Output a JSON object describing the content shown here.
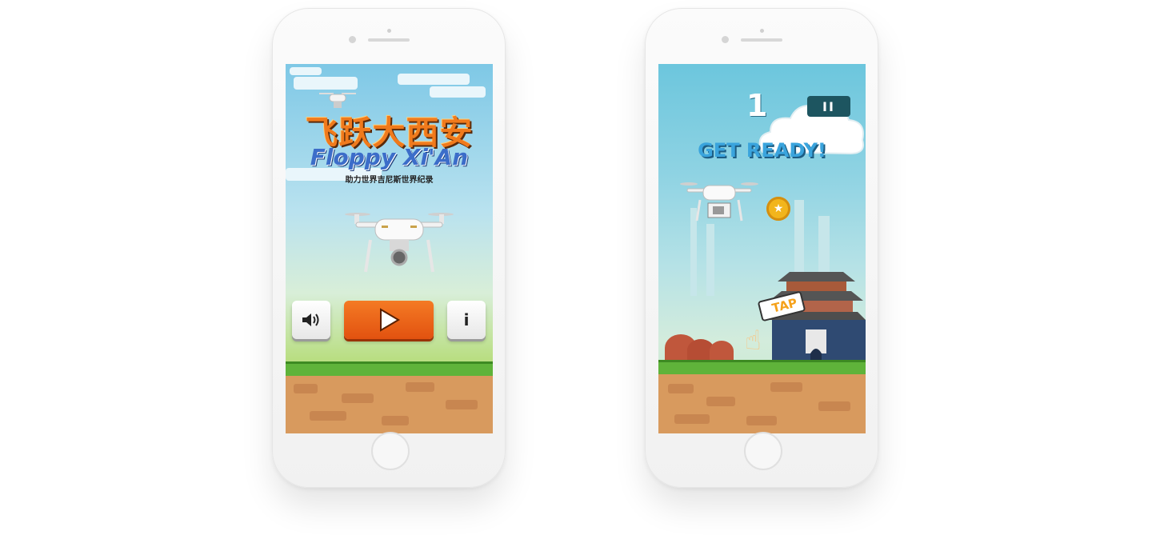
{
  "screen_start": {
    "title_cn": "飞跃大西安",
    "title_en": "Floppy Xi'An",
    "subtitle": "助力世界吉尼斯世界纪录",
    "buttons": {
      "sound_icon": "speaker-icon",
      "play_icon": "play-icon",
      "info_label": "i"
    }
  },
  "screen_game": {
    "score": "1",
    "pause_label": "II",
    "ready_text": "GET READY!",
    "tap_label": "TAP",
    "coin_icon": "star-icon"
  },
  "colors": {
    "accent_orange": "#f07a1c",
    "title_blue": "#3c6dc9",
    "ready_blue": "#3aa4dd",
    "grass": "#5fb33a",
    "dirt": "#d89a5e"
  }
}
